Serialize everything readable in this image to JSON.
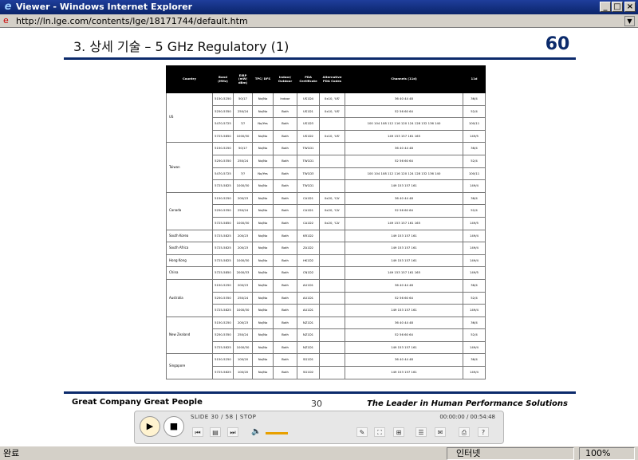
{
  "window": {
    "title": "Viewer - Windows Internet Explorer",
    "minimize": "_",
    "maximize": "□",
    "close": "×"
  },
  "address": {
    "url": "http://ln.lge.com/contents/lge/18171744/default.htm"
  },
  "slide": {
    "title": "3. 상세 기술 – 5 GHz Regulatory (1)",
    "logo_num": "60",
    "footer_left": "Great Company   Great People",
    "page_number": "30",
    "footer_right": "The Leader in Human Performance Solutions"
  },
  "table": {
    "headers": [
      "Country",
      "Band (MHz)",
      "EIRP (mW/ dBm)",
      "TPC/ DFS",
      "Indoor/ Outdoor",
      "PDA Certificate",
      "Alternative PDA Codes",
      "Channels (11d)",
      "11d"
    ],
    "rows": [
      {
        "country": "US",
        "span": 4,
        "band": "5150-5250",
        "eirp": "50/17",
        "tpc": "No/No",
        "indoor": "Indoor",
        "pda": "US1D4",
        "alt": "0x10, 'US'",
        "ch": "36 40 44 48",
        "d": "36/4"
      },
      {
        "band": "5250-5350",
        "eirp": "250/24",
        "tpc": "No/No",
        "indoor": "Both",
        "pda": "US1D1",
        "alt": "0x10, 'US'",
        "ch": "52 56 60 64",
        "d": "52/4"
      },
      {
        "band": "5470-5725",
        "eirp": "?/?",
        "tpc": "No/Yes",
        "indoor": "Both",
        "pda": "US1D3",
        "alt": "",
        "ch": "100 104 108 112 116 120 124 128 132 136 140",
        "d": "100/11"
      },
      {
        "band": "5725-5850",
        "eirp": "1000/30",
        "tpc": "No/No",
        "indoor": "Both",
        "pda": "US1D2",
        "alt": "0x10, 'US'",
        "ch": "149 153 157 161 165",
        "d": "149/5"
      },
      {
        "country": "Taiwan",
        "span": 4,
        "band": "5150-5250",
        "eirp": "50/17",
        "tpc": "No/No",
        "indoor": "Both",
        "pda": "TW1D1",
        "alt": "",
        "ch": "36 40 44 48",
        "d": "36/4"
      },
      {
        "band": "5250-5350",
        "eirp": "250/24",
        "tpc": "No/No",
        "indoor": "Both",
        "pda": "TW1D1",
        "alt": "",
        "ch": "52 56 60 64",
        "d": "52/4"
      },
      {
        "band": "5470-5725",
        "eirp": "?/?",
        "tpc": "No/Yes",
        "indoor": "Both",
        "pda": "TW1D3",
        "alt": "",
        "ch": "100 104 108 112 116 120 124 128 132 136 140",
        "d": "100/11"
      },
      {
        "band": "5725-5825",
        "eirp": "1000/30",
        "tpc": "No/No",
        "indoor": "Both",
        "pda": "TW1D1",
        "alt": "",
        "ch": "149 153 157 161",
        "d": "149/4"
      },
      {
        "country": "Canada",
        "span": 3,
        "band": "5150-5250",
        "eirp": "200/23",
        "tpc": "No/No",
        "indoor": "Both",
        "pda": "CA1D1",
        "alt": "0x20, 'CA'",
        "ch": "36 40 44 48",
        "d": "36/4"
      },
      {
        "band": "5250-5350",
        "eirp": "250/24",
        "tpc": "No/No",
        "indoor": "Both",
        "pda": "CA1D1",
        "alt": "0x20, 'CA'",
        "ch": "52 56 60 64",
        "d": "52/4"
      },
      {
        "band": "5725-5850",
        "eirp": "1000/30",
        "tpc": "No/No",
        "indoor": "Both",
        "pda": "CA1D2",
        "alt": "0x20, 'CA'",
        "ch": "149 153 157 161 165",
        "d": "149/5"
      },
      {
        "country": "South Korea",
        "span": 1,
        "band": "5725-5825",
        "eirp": "200/23",
        "tpc": "No/No",
        "indoor": "Both",
        "pda": "KR1D2",
        "alt": "",
        "ch": "149 153 157 161",
        "d": "149/4"
      },
      {
        "country": "South Africa",
        "span": 1,
        "band": "5725-5825",
        "eirp": "200/23",
        "tpc": "No/No",
        "indoor": "Both",
        "pda": "ZA1D2",
        "alt": "",
        "ch": "149 153 157 161",
        "d": "149/4"
      },
      {
        "country": "Hong Kong",
        "span": 1,
        "band": "5725-5825",
        "eirp": "1000/30",
        "tpc": "No/No",
        "indoor": "Both",
        "pda": "HK1D2",
        "alt": "",
        "ch": "149 153 157 161",
        "d": "149/4"
      },
      {
        "country": "China",
        "span": 1,
        "band": "5725-5850",
        "eirp": "2000/33",
        "tpc": "No/No",
        "indoor": "Both",
        "pda": "CN1D2",
        "alt": "",
        "ch": "149 153 157 161 165",
        "d": "149/5"
      },
      {
        "country": "Australia",
        "span": 3,
        "band": "5150-5250",
        "eirp": "200/23",
        "tpc": "No/No",
        "indoor": "Both",
        "pda": "AU1D1",
        "alt": "",
        "ch": "36 40 44 48",
        "d": "36/4"
      },
      {
        "band": "5250-5350",
        "eirp": "250/24",
        "tpc": "No/No",
        "indoor": "Both",
        "pda": "AU1D1",
        "alt": "",
        "ch": "52 56 60 64",
        "d": "52/4"
      },
      {
        "band": "5725-5825",
        "eirp": "1000/30",
        "tpc": "No/No",
        "indoor": "Both",
        "pda": "AU1D1",
        "alt": "",
        "ch": "149 153 157 161",
        "d": "149/4"
      },
      {
        "country": "New Zealand",
        "span": 3,
        "band": "5150-5250",
        "eirp": "200/23",
        "tpc": "No/No",
        "indoor": "Both",
        "pda": "NZ1D1",
        "alt": "",
        "ch": "36 40 44 48",
        "d": "36/4"
      },
      {
        "band": "5250-5350",
        "eirp": "250/24",
        "tpc": "No/No",
        "indoor": "Both",
        "pda": "NZ1D1",
        "alt": "",
        "ch": "52 56 60 64",
        "d": "52/4"
      },
      {
        "band": "5725-5825",
        "eirp": "1000/30",
        "tpc": "No/No",
        "indoor": "Both",
        "pda": "NZ1D1",
        "alt": "",
        "ch": "149 153 157 161",
        "d": "149/4"
      },
      {
        "country": "Singapore",
        "span": 2,
        "band": "5150-5250",
        "eirp": "100/20",
        "tpc": "No/No",
        "indoor": "Both",
        "pda": "SG1D1",
        "alt": "",
        "ch": "36 40 44 48",
        "d": "36/4"
      },
      {
        "band": "5725-5825",
        "eirp": "100/20",
        "tpc": "No/No",
        "indoor": "Both",
        "pda": "SG1D2",
        "alt": "",
        "ch": "149 153 157 161",
        "d": "149/4"
      }
    ]
  },
  "player": {
    "info": "SLIDE  30 / 58        |  STOP",
    "time": "00:00:00 / 00:54:48",
    "play": "▶",
    "stop": "■"
  },
  "status": {
    "left": "완료",
    "zone": "인터넷",
    "zoom": "100%"
  },
  "colors": {
    "titlebar": "#0a246a",
    "slide_rule": "#0b2a6b",
    "volume": "#e8a000"
  }
}
